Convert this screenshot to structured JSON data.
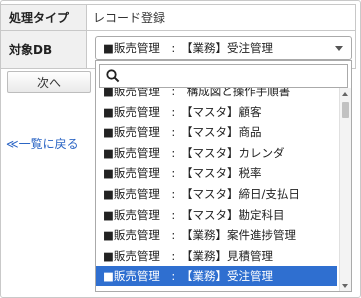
{
  "form": {
    "process_type_label": "処理タイプ",
    "process_type_value": "レコード登録",
    "target_db_label": "対象DB",
    "target_db_selected": "■販売管理　:　【業務】受注管理"
  },
  "buttons": {
    "next_label": "次へ"
  },
  "links": {
    "back_label": "≪一覧に戻る"
  },
  "dropdown": {
    "search_value": "",
    "options": [
      "■販売管理　:　構成図と操作手順書",
      "■販売管理　:　【マスタ】顧客",
      "■販売管理　:　【マスタ】商品",
      "■販売管理　:　【マスタ】カレンダ",
      "■販売管理　:　【マスタ】税率",
      "■販売管理　:　【マスタ】締日/支払日",
      "■販売管理　:　【マスタ】勘定科目",
      "■販売管理　:　【業務】案件進捗管理",
      "■販売管理　:　【業務】見積管理",
      "■販売管理　:　【業務】受注管理"
    ],
    "selected_index": 9
  },
  "colors": {
    "selected_bg": "#2f6fd0",
    "link": "#2a64c4",
    "label_bg": "#f0f0f0"
  },
  "icons": {
    "search": "search-icon",
    "select_arrow": "chevron-down-icon"
  }
}
